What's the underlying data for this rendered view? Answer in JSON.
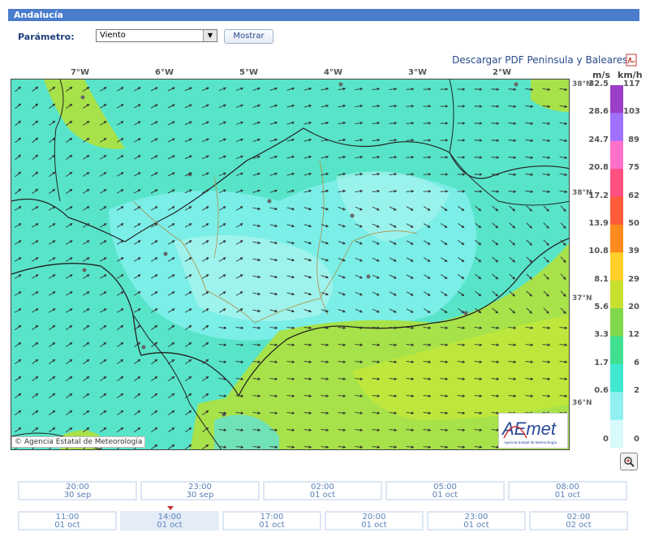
{
  "header": {
    "title": "Andalucía"
  },
  "controls": {
    "param_label": "Parámetro:",
    "param_value": "Viento",
    "show_button": "Mostrar",
    "pdf_link": "Descargar PDF Peninsula y Baleares"
  },
  "map": {
    "longitudes": [
      "7°W",
      "6°W",
      "5°W",
      "4°W",
      "3°W",
      "2°W"
    ],
    "latitudes": [
      "38°N",
      "38°N",
      "37°N",
      "36°N"
    ],
    "copyright": "© Agencia Estatal de Meteorología",
    "logo_text": "AEmet",
    "logo_subtext": "Agencia Estatal de Meteorología"
  },
  "scale": {
    "unit_ms": "m/s",
    "unit_kmh": "km/h",
    "ms": [
      "32.5",
      "28.6",
      "24.7",
      "20.8",
      "17.2",
      "13.9",
      "10.8",
      "8.1",
      "5.6",
      "3.3",
      "1.7",
      "0.6",
      "0"
    ],
    "kmh": [
      "117",
      "103",
      "89",
      "75",
      "62",
      "50",
      "39",
      "29",
      "20",
      "12",
      "6",
      "2",
      "0"
    ],
    "colors": [
      "#9b3fc8",
      "#a070ff",
      "#ff70c8",
      "#ff5080",
      "#ff5a3a",
      "#ff8a1e",
      "#ffd02a",
      "#c8e030",
      "#80d84a",
      "#40e090",
      "#40e8d0",
      "#90f0f0",
      "#d8fafa"
    ]
  },
  "timeline": {
    "row1": [
      {
        "time": "20:00",
        "date": "30 sep"
      },
      {
        "time": "23:00",
        "date": "30 sep"
      },
      {
        "time": "02:00",
        "date": "01 oct"
      },
      {
        "time": "05:00",
        "date": "01 oct"
      },
      {
        "time": "08:00",
        "date": "01 oct"
      }
    ],
    "row2": [
      {
        "time": "11:00",
        "date": "01 oct"
      },
      {
        "time": "14:00",
        "date": "01 oct"
      },
      {
        "time": "17:00",
        "date": "01 oct"
      },
      {
        "time": "20:00",
        "date": "01 oct"
      },
      {
        "time": "23:00",
        "date": "01 oct"
      },
      {
        "time": "02:00",
        "date": "02 oct"
      }
    ],
    "selected": "14:00 01 oct"
  }
}
